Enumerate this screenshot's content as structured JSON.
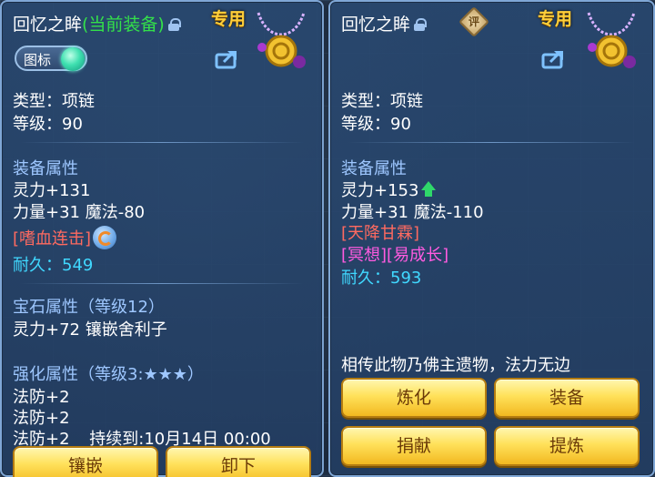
{
  "left": {
    "title": "回忆之眸",
    "status": "(当前装备)",
    "tag": "专用",
    "toggle_label": "图标",
    "type_line": "类型：项链",
    "level_line": "等级：90",
    "attr_heading": "装备属性",
    "attrs": [
      "灵力+131",
      "力量+31 魔法-80"
    ],
    "skill": "[嗜血连击]",
    "durability": "耐久：549",
    "gem_heading": "宝石属性（等级12）",
    "gem_detail": "灵力+72 镶嵌舍利子",
    "enhance_heading": "强化属性（等级3:★★★）",
    "enhance_lines": [
      "法防+2",
      "法防+2"
    ],
    "enhance_last": "法防+2",
    "duration": "持续到:10月14日 00:00",
    "buttons": [
      "镶嵌",
      "卸下"
    ]
  },
  "right": {
    "title": "回忆之眸",
    "appraise": "评",
    "tag": "专用",
    "type_line": "类型：项链",
    "level_line": "等级：90",
    "attr_heading": "装备属性",
    "attrs": [
      "灵力+153",
      "力量+31 魔法-110"
    ],
    "skill": "[天降甘霖]",
    "special": "[冥想][易成长]",
    "durability": "耐久：593",
    "description": "相传此物乃佛主遗物，法力无边",
    "buttons": [
      "炼化",
      "装备",
      "捐献",
      "提炼"
    ]
  },
  "colors": {
    "panel": "#284870",
    "heading": "#9ec7ff",
    "skill": "#ff6a60",
    "special": "#ff5be0",
    "durable": "#40d8ff",
    "tag": "#ffcf3a",
    "status": "#33e04a",
    "button": "#ffe15a"
  },
  "icons": [
    "lock-icon",
    "necklace-icon",
    "share-icon",
    "appraise-icon",
    "refresh-icon",
    "up-arrow-icon"
  ]
}
